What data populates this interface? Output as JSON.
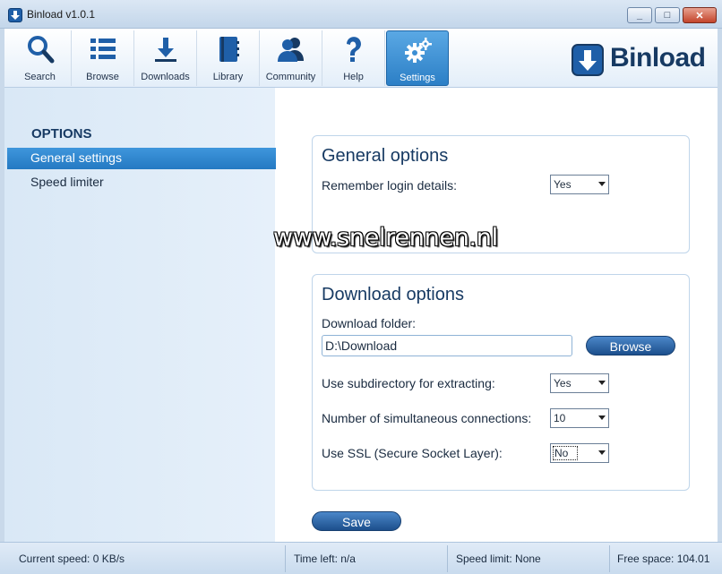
{
  "window": {
    "title": "Binload v1.0.1"
  },
  "toolbar": {
    "items": [
      {
        "label": "Search",
        "icon": "search-icon"
      },
      {
        "label": "Browse",
        "icon": "list-icon"
      },
      {
        "label": "Downloads",
        "icon": "download-icon"
      },
      {
        "label": "Library",
        "icon": "book-icon"
      },
      {
        "label": "Community",
        "icon": "users-icon"
      },
      {
        "label": "Help",
        "icon": "help-icon"
      },
      {
        "label": "Settings",
        "icon": "gear-icon"
      }
    ],
    "active": "Settings"
  },
  "logo": {
    "text": "Binload"
  },
  "sidebar": {
    "heading": "OPTIONS",
    "items": [
      {
        "label": "General settings",
        "selected": true
      },
      {
        "label": "Speed limiter",
        "selected": false
      }
    ]
  },
  "general": {
    "title": "General options",
    "remember_label": "Remember login details:",
    "remember_value": "Yes"
  },
  "download": {
    "title": "Download options",
    "folder_label": "Download folder:",
    "folder_value": "D:\\Download",
    "browse_label": "Browse",
    "subdir_label": "Use subdirectory for extracting:",
    "subdir_value": "Yes",
    "connections_label": "Number of simultaneous connections:",
    "connections_value": "10",
    "ssl_label": "Use SSL (Secure Socket Layer):",
    "ssl_value": "No"
  },
  "save_label": "Save",
  "watermark": "www.snelrennen.nl",
  "status": {
    "speed": "Current speed: 0 KB/s",
    "time_left": "Time left: n/a",
    "speed_limit": "Speed limit: None",
    "free_space": "Free space: 104.01"
  },
  "colors": {
    "accent": "#2c7fc6",
    "navy": "#173a63"
  }
}
